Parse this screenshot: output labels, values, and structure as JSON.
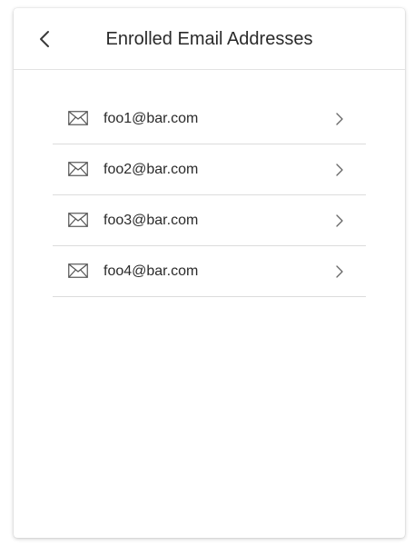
{
  "header": {
    "title": "Enrolled Email Addresses",
    "back_icon": "chevron-left-icon"
  },
  "emails": [
    {
      "address": "foo1@bar.com",
      "icon": "envelope-icon",
      "action_icon": "chevron-right-icon"
    },
    {
      "address": "foo2@bar.com",
      "icon": "envelope-icon",
      "action_icon": "chevron-right-icon"
    },
    {
      "address": "foo3@bar.com",
      "icon": "envelope-icon",
      "action_icon": "chevron-right-icon"
    },
    {
      "address": "foo4@bar.com",
      "icon": "envelope-icon",
      "action_icon": "chevron-right-icon"
    }
  ],
  "colors": {
    "text": "#2a2a2a",
    "divider": "#dcdcdc",
    "icon": "#555555"
  }
}
